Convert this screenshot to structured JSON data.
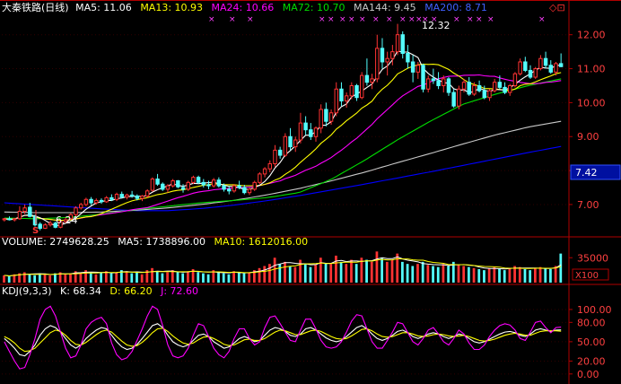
{
  "header": {
    "title": "大秦铁路(日线)",
    "ma5": "MA5: 11.06",
    "ma13": "MA13: 10.93",
    "ma24": "MA24: 10.66",
    "ma72": "MA72: 10.70",
    "ma144": "MA144: 9.45",
    "ma200": "MA200: 8.71",
    "nav_glyph": "◇⊡"
  },
  "volume_header": {
    "label": "VOLUME: 2749628.25",
    "ma5": "MA5: 1738896.00",
    "ma10": "MA10: 1612016.00"
  },
  "kdj_header": {
    "label": "KDJ(9,3,3)",
    "k": "K: 68.34",
    "d": "D: 66.20",
    "j": "J: 72.60"
  },
  "colors": {
    "up": "#ff3333",
    "down": "#54ffff",
    "ma5": "#ffffff",
    "ma13": "#ffff00",
    "ma24": "#ff00ff",
    "ma72": "#00dd00",
    "ma144": "#c8c8c8",
    "ma200": "#0000ff",
    "axis": "#b00000",
    "tick": "#ff4040"
  },
  "chart_data": [
    {
      "type": "candlestick",
      "price_axis": {
        "ticks": [
          "12.00",
          "11.00",
          "10.00",
          "9.00",
          "8.00",
          "7.00"
        ],
        "ylim": [
          6.1,
          12.6
        ]
      },
      "current_price": "7.42",
      "annotations": {
        "high": "12.32",
        "low": "6.24",
        "signal": "S"
      },
      "candles": [
        [
          6.55,
          6.6,
          6.5,
          6.58
        ],
        [
          6.58,
          6.65,
          6.53,
          6.55
        ],
        [
          6.55,
          6.6,
          6.5,
          6.58
        ],
        [
          6.58,
          6.95,
          6.55,
          6.8
        ],
        [
          6.8,
          7.0,
          6.72,
          6.9
        ],
        [
          6.92,
          7.05,
          6.62,
          6.65
        ],
        [
          6.65,
          6.7,
          6.35,
          6.4
        ],
        [
          6.42,
          6.48,
          6.24,
          6.3
        ],
        [
          6.3,
          6.45,
          6.28,
          6.4
        ],
        [
          6.4,
          6.52,
          6.35,
          6.45
        ],
        [
          6.45,
          6.5,
          6.3,
          6.33
        ],
        [
          6.33,
          6.55,
          6.3,
          6.5
        ],
        [
          6.5,
          6.62,
          6.45,
          6.55
        ],
        [
          6.58,
          6.75,
          6.55,
          6.7
        ],
        [
          6.7,
          6.95,
          6.65,
          6.9
        ],
        [
          6.9,
          7.05,
          6.85,
          7.0
        ],
        [
          7.0,
          7.2,
          6.95,
          7.15
        ],
        [
          7.15,
          7.22,
          6.98,
          7.05
        ],
        [
          7.05,
          7.18,
          7.0,
          7.12
        ],
        [
          7.12,
          7.18,
          7.02,
          7.08
        ],
        [
          7.08,
          7.25,
          7.05,
          7.2
        ],
        [
          7.2,
          7.3,
          7.1,
          7.15
        ],
        [
          7.15,
          7.35,
          7.1,
          7.3
        ],
        [
          7.3,
          7.38,
          7.18,
          7.22
        ],
        [
          7.22,
          7.32,
          7.15,
          7.28
        ],
        [
          7.28,
          7.4,
          7.2,
          7.25
        ],
        [
          7.25,
          7.3,
          7.12,
          7.18
        ],
        [
          7.18,
          7.28,
          7.1,
          7.25
        ],
        [
          7.25,
          7.45,
          7.2,
          7.4
        ],
        [
          7.42,
          7.8,
          7.38,
          7.75
        ],
        [
          7.75,
          7.9,
          7.55,
          7.6
        ],
        [
          7.6,
          7.65,
          7.4,
          7.45
        ],
        [
          7.45,
          7.6,
          7.35,
          7.55
        ],
        [
          7.55,
          7.75,
          7.5,
          7.7
        ],
        [
          7.7,
          7.72,
          7.48,
          7.52
        ],
        [
          7.5,
          7.6,
          7.35,
          7.45
        ],
        [
          7.45,
          7.7,
          7.4,
          7.65
        ],
        [
          7.65,
          7.85,
          7.6,
          7.8
        ],
        [
          7.8,
          7.85,
          7.6,
          7.65
        ],
        [
          7.65,
          7.75,
          7.5,
          7.58
        ],
        [
          7.58,
          7.7,
          7.45,
          7.55
        ],
        [
          7.55,
          7.78,
          7.5,
          7.72
        ],
        [
          7.72,
          7.8,
          7.5,
          7.55
        ],
        [
          7.55,
          7.62,
          7.38,
          7.45
        ],
        [
          7.45,
          7.55,
          7.3,
          7.4
        ],
        [
          7.4,
          7.6,
          7.35,
          7.55
        ],
        [
          7.55,
          7.7,
          7.45,
          7.5
        ],
        [
          7.5,
          7.58,
          7.3,
          7.35
        ],
        [
          7.35,
          7.5,
          7.28,
          7.45
        ],
        [
          7.45,
          7.7,
          7.4,
          7.65
        ],
        [
          7.65,
          7.95,
          7.6,
          7.9
        ],
        [
          7.9,
          8.1,
          7.8,
          8.05
        ],
        [
          8.05,
          8.3,
          7.95,
          8.2
        ],
        [
          8.2,
          8.75,
          8.1,
          8.6
        ],
        [
          8.6,
          8.7,
          8.35,
          8.45
        ],
        [
          8.45,
          9.1,
          8.4,
          9.0
        ],
        [
          9.0,
          9.25,
          8.6,
          8.7
        ],
        [
          8.7,
          9.0,
          8.55,
          8.9
        ],
        [
          8.9,
          9.7,
          8.8,
          9.4
        ],
        [
          9.4,
          9.6,
          9.05,
          9.2
        ],
        [
          9.2,
          9.4,
          8.9,
          9.0
        ],
        [
          9.0,
          9.3,
          8.85,
          9.25
        ],
        [
          9.25,
          9.95,
          9.1,
          9.8
        ],
        [
          9.8,
          10.0,
          9.3,
          9.45
        ],
        [
          9.45,
          9.8,
          9.35,
          9.7
        ],
        [
          9.7,
          10.6,
          9.6,
          10.4
        ],
        [
          10.4,
          10.6,
          9.9,
          10.05
        ],
        [
          10.05,
          10.3,
          9.85,
          10.2
        ],
        [
          10.2,
          10.6,
          10.1,
          10.5
        ],
        [
          10.5,
          10.55,
          10.05,
          10.15
        ],
        [
          10.15,
          10.9,
          10.1,
          10.8
        ],
        [
          10.8,
          11.3,
          10.5,
          10.6
        ],
        [
          10.6,
          10.85,
          10.4,
          10.7
        ],
        [
          10.7,
          12.0,
          10.6,
          11.6
        ],
        [
          11.6,
          11.9,
          11.0,
          11.2
        ],
        [
          11.2,
          11.5,
          10.8,
          11.3
        ],
        [
          11.3,
          11.7,
          11.1,
          11.5
        ],
        [
          11.5,
          12.32,
          11.4,
          12.0
        ],
        [
          12.0,
          12.1,
          11.3,
          11.45
        ],
        [
          11.45,
          11.7,
          11.0,
          11.2
        ],
        [
          11.2,
          11.4,
          10.6,
          10.9
        ],
        [
          10.9,
          11.2,
          10.7,
          11.1
        ],
        [
          11.1,
          11.15,
          10.3,
          10.4
        ],
        [
          10.4,
          10.8,
          10.3,
          10.7
        ],
        [
          10.7,
          11.0,
          10.55,
          10.65
        ],
        [
          10.65,
          10.9,
          10.4,
          10.5
        ],
        [
          10.5,
          10.8,
          10.3,
          10.7
        ],
        [
          10.7,
          10.75,
          10.2,
          10.3
        ],
        [
          10.3,
          10.4,
          9.85,
          9.9
        ],
        [
          9.9,
          10.5,
          9.8,
          10.4
        ],
        [
          10.4,
          10.7,
          10.3,
          10.6
        ],
        [
          10.6,
          10.75,
          10.2,
          10.25
        ],
        [
          10.25,
          10.6,
          10.2,
          10.5
        ],
        [
          10.5,
          10.65,
          10.3,
          10.35
        ],
        [
          10.35,
          10.5,
          10.1,
          10.15
        ],
        [
          10.15,
          10.4,
          10.05,
          10.35
        ],
        [
          10.35,
          10.7,
          10.3,
          10.6
        ],
        [
          10.6,
          10.8,
          10.4,
          10.45
        ],
        [
          10.45,
          10.6,
          10.25,
          10.3
        ],
        [
          10.3,
          10.55,
          10.2,
          10.5
        ],
        [
          10.5,
          10.9,
          10.45,
          10.85
        ],
        [
          10.85,
          11.3,
          10.8,
          11.2
        ],
        [
          11.2,
          11.35,
          10.9,
          10.95
        ],
        [
          10.95,
          11.1,
          10.7,
          10.75
        ],
        [
          10.75,
          11.05,
          10.7,
          11.0
        ],
        [
          11.0,
          11.4,
          10.95,
          11.3
        ],
        [
          11.3,
          11.5,
          11.0,
          11.1
        ],
        [
          11.1,
          11.25,
          10.85,
          10.9
        ],
        [
          10.9,
          11.2,
          10.8,
          11.15
        ],
        [
          11.15,
          11.45,
          11.05,
          11.06
        ]
      ],
      "ma_lines": {
        "ma200": [
          7.05,
          6.99,
          6.93,
          6.87,
          6.82,
          6.82,
          6.88,
          6.98,
          7.11,
          7.26,
          7.43,
          7.6,
          7.78,
          7.96,
          8.15,
          8.34,
          8.53,
          8.71
        ],
        "ma144": [
          6.78,
          6.76,
          6.76,
          6.78,
          6.83,
          6.9,
          7.0,
          7.12,
          7.28,
          7.47,
          7.7,
          7.95,
          8.23,
          8.5,
          8.78,
          9.05,
          9.28,
          9.45
        ],
        "ma72": [
          6.6,
          6.58,
          6.62,
          6.72,
          6.85,
          6.95,
          7.05,
          7.12,
          7.2,
          7.35,
          7.75,
          8.3,
          8.9,
          9.45,
          9.95,
          10.25,
          10.5,
          10.7
        ]
      }
    },
    {
      "type": "bar",
      "name": "VOLUME",
      "ticks": [
        "35000"
      ],
      "unit": "X100",
      "values": [
        7,
        6,
        8,
        9,
        10,
        8,
        7,
        9,
        8,
        7,
        9,
        10,
        8,
        9,
        11,
        10,
        12,
        9,
        8,
        10,
        11,
        9,
        10,
        12,
        11,
        9,
        10,
        8,
        12,
        14,
        11,
        9,
        10,
        12,
        10,
        9,
        11,
        13,
        10,
        9,
        8,
        12,
        10,
        9,
        8,
        11,
        10,
        9,
        10,
        12,
        14,
        16,
        18,
        24,
        18,
        20,
        16,
        15,
        22,
        18,
        15,
        17,
        24,
        19,
        18,
        26,
        20,
        18,
        22,
        18,
        24,
        22,
        20,
        30,
        24,
        20,
        22,
        28,
        20,
        18,
        16,
        18,
        20,
        17,
        16,
        15,
        18,
        16,
        20,
        17,
        16,
        15,
        14,
        13,
        12,
        14,
        15,
        13,
        12,
        14,
        16,
        15,
        13,
        12,
        14,
        15,
        14,
        13,
        16,
        28
      ]
    },
    {
      "type": "line",
      "name": "KDJ",
      "ticks": [
        "100.00",
        "80.00",
        "50.00",
        "20.00",
        "0.00"
      ],
      "ylim": [
        -10,
        118
      ],
      "series": [
        {
          "name": "K",
          "values": [
            55,
            48,
            40,
            30,
            28,
            35,
            45,
            60,
            70,
            75,
            72,
            65,
            55,
            45,
            40,
            45,
            55,
            62,
            68,
            72,
            70,
            60,
            50,
            42,
            38,
            40,
            46,
            55,
            65,
            75,
            78,
            72,
            60,
            50,
            45,
            42,
            45,
            52,
            60,
            62,
            58,
            50,
            45,
            40,
            42,
            48,
            55,
            58,
            55,
            50,
            52,
            60,
            68,
            72,
            70,
            66,
            60,
            58,
            62,
            70,
            72,
            68,
            62,
            56,
            52,
            50,
            52,
            58,
            65,
            72,
            75,
            70,
            62,
            55,
            52,
            55,
            60,
            66,
            68,
            64,
            58,
            55,
            58,
            62,
            64,
            62,
            58,
            55,
            58,
            62,
            60,
            55,
            50,
            48,
            50,
            54,
            58,
            62,
            65,
            66,
            64,
            60,
            58,
            62,
            68,
            70,
            68,
            66,
            68,
            68.34
          ]
        },
        {
          "name": "D",
          "values": [
            58,
            54,
            48,
            40,
            35,
            36,
            40,
            48,
            56,
            64,
            68,
            66,
            60,
            52,
            46,
            45,
            49,
            55,
            61,
            66,
            68,
            65,
            58,
            51,
            45,
            43,
            44,
            49,
            56,
            64,
            70,
            71,
            66,
            59,
            53,
            48,
            46,
            48,
            53,
            57,
            58,
            55,
            51,
            46,
            44,
            45,
            49,
            53,
            54,
            52,
            52,
            55,
            60,
            65,
            68,
            67,
            64,
            61,
            61,
            64,
            67,
            68,
            66,
            62,
            58,
            55,
            54,
            55,
            59,
            64,
            69,
            70,
            67,
            62,
            58,
            57,
            58,
            61,
            64,
            64,
            62,
            59,
            58,
            59,
            61,
            62,
            61,
            59,
            58,
            59,
            60,
            58,
            55,
            52,
            51,
            52,
            54,
            57,
            60,
            62,
            63,
            62,
            60,
            60,
            63,
            66,
            67,
            67,
            67,
            66.2
          ]
        },
        {
          "name": "J",
          "values": [
            50,
            35,
            20,
            8,
            10,
            30,
            55,
            85,
            100,
            105,
            90,
            65,
            40,
            25,
            28,
            45,
            70,
            80,
            85,
            88,
            78,
            48,
            30,
            22,
            25,
            35,
            52,
            70,
            90,
            105,
            100,
            75,
            45,
            28,
            25,
            28,
            40,
            60,
            78,
            75,
            58,
            40,
            30,
            25,
            35,
            55,
            70,
            70,
            55,
            45,
            50,
            72,
            88,
            90,
            78,
            65,
            52,
            50,
            68,
            85,
            85,
            70,
            52,
            42,
            40,
            42,
            50,
            65,
            82,
            92,
            90,
            70,
            50,
            40,
            40,
            52,
            65,
            80,
            78,
            64,
            50,
            45,
            55,
            68,
            72,
            62,
            50,
            45,
            55,
            68,
            62,
            48,
            38,
            38,
            45,
            58,
            68,
            75,
            78,
            76,
            68,
            55,
            52,
            65,
            80,
            82,
            72,
            64,
            72,
            72.6
          ]
        }
      ]
    }
  ]
}
